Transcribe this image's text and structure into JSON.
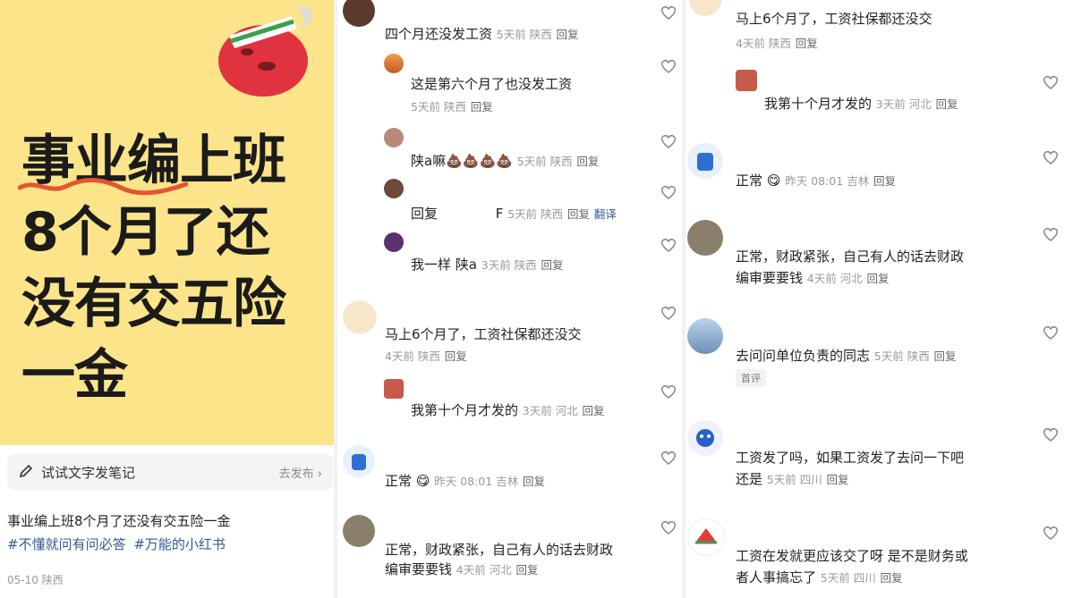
{
  "panel1": {
    "cover_lines": [
      "事业编上班",
      "8个月了还",
      "没有交五险",
      "一金"
    ],
    "try_text": "试试文字发笔记",
    "try_go": "去发布 ›",
    "post_title": "事业编上班8个月了还没有交五险一金",
    "tags": [
      "#不懂就问有问必答",
      "#万能的小红书"
    ],
    "meta": "05-10 陕西"
  },
  "panel2": {
    "c1": {
      "text": "四个月还没发工资",
      "meta": "5天前 陕西",
      "reply": "回复"
    },
    "c2": {
      "text": "这是第六个月了也没发工资",
      "meta": "5天前 陕西",
      "reply": "回复"
    },
    "c3": {
      "text": "陕a嘛💩💩💩💩",
      "meta": "5天前 陕西",
      "reply": "回复"
    },
    "c4": {
      "text": "回复",
      "extra": "F",
      "meta": "5天前 陕西",
      "reply": "回复",
      "translate": "翻译"
    },
    "c5": {
      "text": "我一样 陕a",
      "meta": "3天前 陕西",
      "reply": "回复"
    },
    "c6": {
      "text": "马上6个月了，工资社保都还没交",
      "meta": "4天前 陕西",
      "reply": "回复"
    },
    "c7": {
      "text": "我第十个月才发的",
      "meta": "3天前 河北",
      "reply": "回复"
    },
    "c8": {
      "text": "正常",
      "meta": "昨天 08:01 吉林",
      "reply": "回复"
    },
    "c9": {
      "line1": "正常，财政紧张，自己有人的话去财政",
      "line2": "编审要要钱",
      "meta": "4天前 河北",
      "reply": "回复"
    }
  },
  "panel3": {
    "c1": {
      "text": "马上6个月了，工资社保都还没交",
      "meta": "4天前 陕西",
      "reply": "回复"
    },
    "c2": {
      "text": "我第十个月才发的",
      "meta": "3天前 河北",
      "reply": "回复"
    },
    "c3": {
      "text": "正常",
      "meta": "昨天 08:01 吉林",
      "reply": "回复"
    },
    "c4": {
      "line1": "正常，财政紧张，自己有人的话去财政",
      "line2": "编审要要钱",
      "meta": "4天前 河北",
      "reply": "回复"
    },
    "c5": {
      "text": "去问问单位负责的同志",
      "meta": "5天前 陕西",
      "reply": "回复",
      "tag": "首评"
    },
    "c6": {
      "line1": "工资发了吗，如果工资发了去问一下吧",
      "line2": "还是",
      "meta": "5天前 四川",
      "reply": "回复"
    },
    "c7": {
      "line1": "工资在发就更应该交了呀 是不是财务或",
      "line2": "者人事搞忘了",
      "meta": "5天前 四川",
      "reply": "回复"
    }
  }
}
